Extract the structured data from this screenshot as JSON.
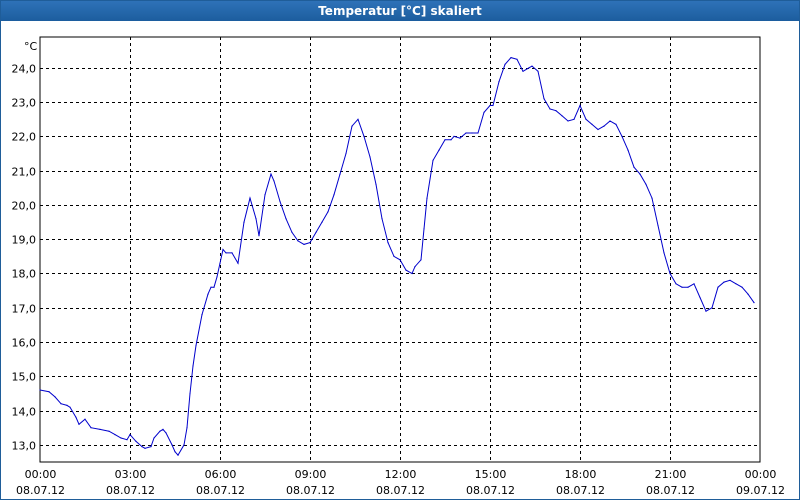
{
  "window": {
    "title": "Temperatur [°C] skaliert"
  },
  "colors": {
    "titlebar": "#1f5f9f",
    "line": "#0000cc",
    "grid": "#000000",
    "background": "#ffffff"
  },
  "chart_data": {
    "type": "line",
    "title": "Temperatur [°C] skaliert",
    "ylabel": "°C",
    "xlabel": "",
    "ylim": [
      12.5,
      24.9
    ],
    "xlim": [
      0,
      24
    ],
    "grid": true,
    "y_ticks": [
      "24,0",
      "23,0",
      "22,0",
      "21,0",
      "20,0",
      "19,0",
      "18,0",
      "17,0",
      "16,0",
      "15,0",
      "14,0",
      "13,0"
    ],
    "y_tick_values": [
      24,
      23,
      22,
      21,
      20,
      19,
      18,
      17,
      16,
      15,
      14,
      13
    ],
    "x_ticks": [
      {
        "time": "00:00",
        "date": "08.07.12"
      },
      {
        "time": "03:00",
        "date": "08.07.12"
      },
      {
        "time": "06:00",
        "date": "08.07.12"
      },
      {
        "time": "09:00",
        "date": "08.07.12"
      },
      {
        "time": "12:00",
        "date": "08.07.12"
      },
      {
        "time": "15:00",
        "date": "08.07.12"
      },
      {
        "time": "18:00",
        "date": "08.07.12"
      },
      {
        "time": "21:00",
        "date": "08.07.12"
      },
      {
        "time": "00:00",
        "date": "09.07.12"
      }
    ],
    "series": [
      {
        "x": [
          0.0,
          0.3,
          0.5,
          0.7,
          0.9,
          1.0,
          1.2,
          1.3,
          1.5,
          1.7,
          2.0,
          2.3,
          2.5,
          2.7,
          2.9,
          3.0,
          3.2,
          3.4,
          3.5,
          3.7,
          3.8,
          4.0,
          4.1,
          4.2,
          4.4,
          4.5,
          4.6,
          4.8,
          4.9,
          5.0,
          5.1,
          5.2,
          5.4,
          5.6,
          5.7,
          5.8,
          5.9,
          6.0,
          6.1,
          6.2,
          6.4,
          6.6,
          6.8,
          7.0,
          7.2,
          7.3,
          7.5,
          7.7,
          7.8,
          8.0,
          8.2,
          8.4,
          8.6,
          8.8,
          9.0,
          9.2,
          9.4,
          9.6,
          9.8,
          10.0,
          10.2,
          10.4,
          10.6,
          10.8,
          11.0,
          11.2,
          11.4,
          11.6,
          11.8,
          12.0,
          12.2,
          12.4,
          12.5,
          12.7,
          12.8,
          12.9,
          13.1,
          13.3,
          13.5,
          13.7,
          13.8,
          14.0,
          14.2,
          14.4,
          14.6,
          14.8,
          15.0,
          15.1,
          15.3,
          15.5,
          15.7,
          15.9,
          16.1,
          16.3,
          16.4,
          16.6,
          16.8,
          17.0,
          17.2,
          17.4,
          17.6,
          17.8,
          18.0,
          18.2,
          18.4,
          18.6,
          18.8,
          19.0,
          19.2,
          19.4,
          19.6,
          19.8,
          20.0,
          20.2,
          20.4,
          20.6,
          20.8,
          21.0,
          21.2,
          21.4,
          21.6,
          21.8,
          22.0,
          22.2,
          22.4,
          22.6,
          22.8,
          23.0,
          23.2,
          23.4,
          23.6,
          23.8
        ],
        "y": [
          14.6,
          14.55,
          14.4,
          14.2,
          14.15,
          14.1,
          13.8,
          13.6,
          13.75,
          13.5,
          13.45,
          13.4,
          13.3,
          13.2,
          13.15,
          13.3,
          13.1,
          12.95,
          12.9,
          12.95,
          13.2,
          13.4,
          13.45,
          13.35,
          13.0,
          12.8,
          12.7,
          13.0,
          13.5,
          14.5,
          15.3,
          15.9,
          16.8,
          17.4,
          17.6,
          17.6,
          17.9,
          18.3,
          18.7,
          18.6,
          18.6,
          18.3,
          19.5,
          20.2,
          19.6,
          19.1,
          20.3,
          20.9,
          20.7,
          20.1,
          19.6,
          19.2,
          18.95,
          18.85,
          18.9,
          19.2,
          19.5,
          19.8,
          20.3,
          20.9,
          21.5,
          22.3,
          22.5,
          22.0,
          21.4,
          20.6,
          19.6,
          18.9,
          18.5,
          18.4,
          18.1,
          18.0,
          18.2,
          18.4,
          19.3,
          20.2,
          21.3,
          21.6,
          21.9,
          21.9,
          22.0,
          21.95,
          22.1,
          22.1,
          22.1,
          22.7,
          22.9,
          22.9,
          23.6,
          24.1,
          24.3,
          24.25,
          23.9,
          24.0,
          24.05,
          23.9,
          23.1,
          22.8,
          22.75,
          22.6,
          22.45,
          22.5,
          22.9,
          22.5,
          22.35,
          22.2,
          22.3,
          22.45,
          22.35,
          22.0,
          21.6,
          21.1,
          20.9,
          20.6,
          20.2,
          19.4,
          18.6,
          18.0,
          17.7,
          17.6,
          17.6,
          17.7,
          17.3,
          16.9,
          17.0,
          17.6,
          17.75,
          17.8,
          17.7,
          17.6,
          17.4,
          17.15
        ]
      }
    ]
  }
}
